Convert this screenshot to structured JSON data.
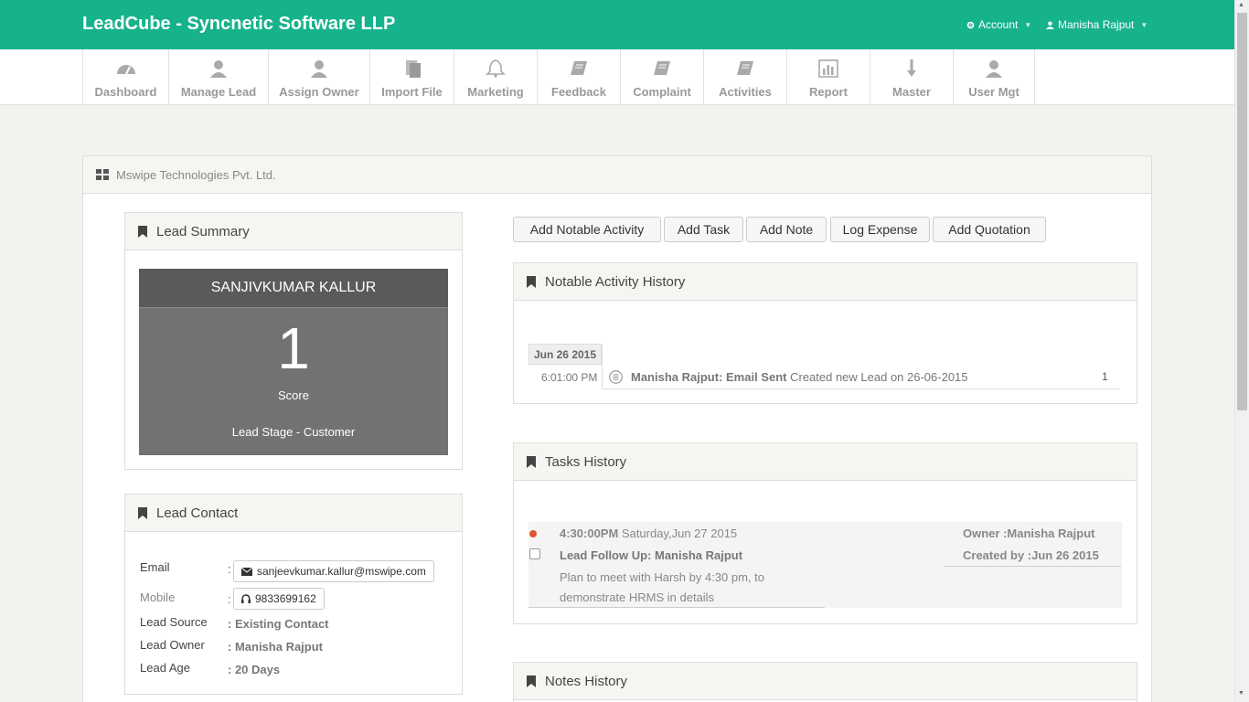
{
  "header": {
    "brand": "LeadCube - Syncnetic Software LLP",
    "account_label": "Account",
    "user_label": "Manisha Rajput"
  },
  "nav": [
    {
      "label": "Dashboard",
      "icon": "dashboard-icon"
    },
    {
      "label": "Manage Lead",
      "icon": "user-icon"
    },
    {
      "label": "Assign Owner",
      "icon": "user-icon"
    },
    {
      "label": "Import File",
      "icon": "file-icon"
    },
    {
      "label": "Marketing",
      "icon": "bell-icon"
    },
    {
      "label": "Feedback",
      "icon": "book-icon"
    },
    {
      "label": "Complaint",
      "icon": "book-icon"
    },
    {
      "label": "Activities",
      "icon": "book-icon"
    },
    {
      "label": "Report",
      "icon": "bar-chart-icon"
    },
    {
      "label": "Master",
      "icon": "arrow-down-icon"
    },
    {
      "label": "User Mgt",
      "icon": "user-icon"
    }
  ],
  "company": {
    "name": "Mswipe Technologies Pvt. Ltd."
  },
  "lead_summary": {
    "title": "Lead Summary",
    "name": "SANJIVKUMAR KALLUR",
    "score": "1",
    "score_label": "Score",
    "stage": "Lead Stage - Customer"
  },
  "lead_contact": {
    "title": "Lead Contact",
    "email_label": "Email",
    "email": "sanjeevkumar.kallur@mswipe.com",
    "mobile_label": "Mobile",
    "mobile": "9833699162",
    "source_label": "Lead Source",
    "source": ": Existing Contact",
    "owner_label": "Lead Owner",
    "owner": ": Manisha Rajput",
    "age_label": "Lead Age",
    "age": ": 20 Days"
  },
  "actions": {
    "notable": "Add Notable Activity",
    "task": "Add Task",
    "note": "Add Note",
    "expense": "Log Expense",
    "quotation": "Add Quotation"
  },
  "notable_history": {
    "title": "Notable Activity History",
    "date": "Jun 26 2015",
    "time": "6:01:00 PM",
    "entry_bold": "Manisha Rajput: Email Sent",
    "entry_text": " Created new Lead on 26-06-2015",
    "count": "1"
  },
  "tasks_history": {
    "title": "Tasks History",
    "time": "4:30:00PM",
    "date": " Saturday,Jun 27 2015",
    "subject": "Lead Follow Up: Manisha Rajput",
    "desc_line1": "Plan to meet with Harsh by 4:30 pm, to",
    "desc_line2": "demonstrate HRMS in details",
    "owner": "Owner :Manisha Rajput",
    "created": "Created by :Jun 26 2015"
  },
  "notes_history": {
    "title": "Notes History"
  },
  "colors": {
    "brand": "#16b28c",
    "summary_dark": "#5a5a5a",
    "summary": "#727272",
    "task_dot": "#e0532f"
  }
}
